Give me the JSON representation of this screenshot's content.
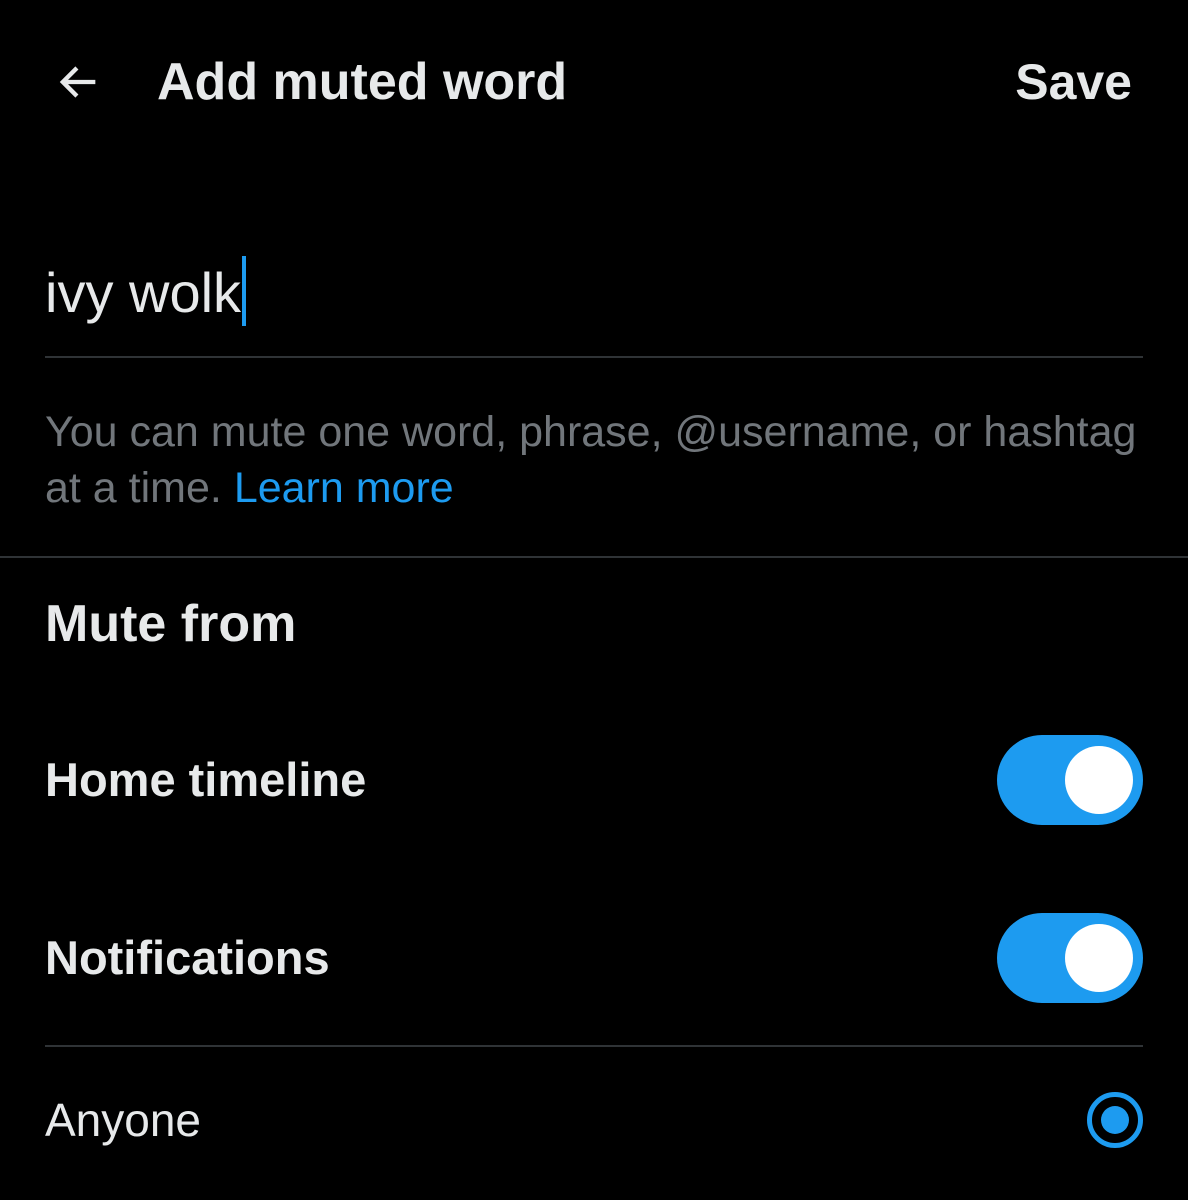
{
  "header": {
    "back_icon": "arrow-left-icon",
    "title": "Add muted word",
    "save_label": "Save"
  },
  "word_field": {
    "value": "ivy wolk"
  },
  "help": {
    "text": "You can mute one word, phrase, @username, or hashtag at a time.",
    "link_label": "Learn more"
  },
  "mute_from": {
    "title": "Mute from",
    "options": [
      {
        "label": "Home timeline",
        "enabled": true
      },
      {
        "label": "Notifications",
        "enabled": true
      }
    ]
  },
  "audience": {
    "label": "Anyone",
    "selected": true
  },
  "colors": {
    "background": "#000000",
    "accent": "#1d9bf0",
    "text": "#e7e9ea",
    "secondary_text": "#71767b",
    "divider": "#2f3336"
  }
}
